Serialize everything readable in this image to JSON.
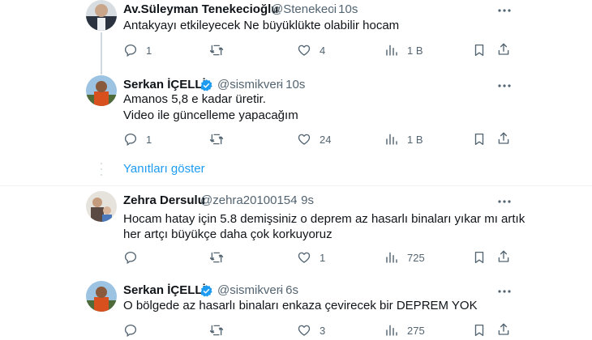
{
  "colors": {
    "accent": "#1d9bf0",
    "muted": "#536471",
    "line": "#cfd9de"
  },
  "tweets": [
    {
      "name": "Av.Süleyman Tenekecioğlu",
      "handle": "@Stenekeci",
      "time": "· 10s",
      "verified": false,
      "lines": [
        "Antakyayı etkileyecek Ne büyüklükte olabilir hocam"
      ],
      "replies": "1",
      "retweets": "",
      "likes": "4",
      "views": "1 B"
    },
    {
      "name": "Serkan İÇELLİ",
      "handle": "@sismikveri",
      "time": "· 10s",
      "verified": true,
      "lines": [
        "Amanos 5,8 e kadar üretir.",
        "Video ile güncelleme yapacağım"
      ],
      "replies": "1",
      "retweets": "",
      "likes": "24",
      "views": "1 B"
    },
    {
      "name": "Zehra Dersulu",
      "handle": "@zehra20100154",
      "time": "· 9s",
      "verified": false,
      "lines": [
        "Hocam hatay için 5.8 demişsiniz o deprem az hasarlı binaları yıkar mı artık",
        "her artçı büyükçe daha çok korkuyoruz"
      ],
      "replies": "",
      "retweets": "",
      "likes": "1",
      "views": "725"
    },
    {
      "name": "Serkan İÇELLİ",
      "handle": "@sismikveri",
      "time": "· 6s",
      "verified": true,
      "lines": [
        "O bölgede az hasarlı binaları enkaza çevirecek bir DEPREM YOK"
      ],
      "replies": "",
      "retweets": "",
      "likes": "3",
      "views": "275"
    }
  ],
  "show_replies": "Yanıtları göster"
}
